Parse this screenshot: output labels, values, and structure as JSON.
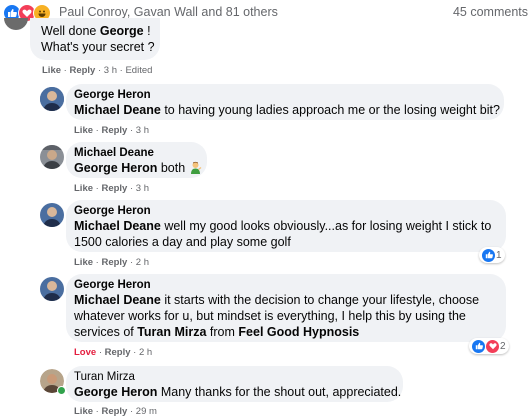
{
  "header": {
    "reactions": [
      "like",
      "love",
      "haha"
    ],
    "names": "Paul Conroy, Gavan Wall and 81 others",
    "comments_count": "45 comments"
  },
  "comments": [
    {
      "author": "",
      "lines": [
        [
          {
            "t": "Well done "
          },
          {
            "t": "George",
            "b": true
          },
          {
            "t": " !"
          }
        ],
        [
          {
            "t": "What's your secret ?"
          }
        ]
      ],
      "like": "Like",
      "reply": "Reply",
      "time": "3 h",
      "edited": "Edited"
    },
    {
      "author": "George Heron",
      "lines": [
        [
          {
            "t": "Michael Deane",
            "b": true
          },
          {
            "t": " to having young ladies approach me or the losing weight bit?"
          }
        ]
      ],
      "like": "Like",
      "reply": "Reply",
      "time": "3 h"
    },
    {
      "author": "Michael Deane",
      "lines": [
        [
          {
            "t": "George Heron",
            "b": true
          },
          {
            "t": " both "
          }
        ]
      ],
      "emoji": "man-gesturing-icon",
      "like": "Like",
      "reply": "Reply",
      "time": "3 h"
    },
    {
      "author": "George Heron",
      "lines": [
        [
          {
            "t": "Michael Deane",
            "b": true
          },
          {
            "t": " well my good looks obviously...as for losing weight I stick to"
          }
        ],
        [
          {
            "t": "1500 calories a day and play some golf"
          }
        ]
      ],
      "like": "Like",
      "reply": "Reply",
      "time": "2 h",
      "reaction_count": "1"
    },
    {
      "author": "George Heron",
      "lines": [
        [
          {
            "t": "Michael Deane",
            "b": true
          },
          {
            "t": " it starts with the decision to change your lifestyle, choose"
          }
        ],
        [
          {
            "t": "whatever works for u, but mindset is everything, I help this by using the"
          }
        ],
        [
          {
            "t": "services of "
          },
          {
            "t": "Turan Mirza",
            "b": true
          },
          {
            "t": " from "
          },
          {
            "t": "Feel Good Hypnosis",
            "b": true
          }
        ]
      ],
      "like": "Love",
      "reply": "Reply",
      "time": "2 h",
      "reaction_count": "2"
    },
    {
      "author": "Turan Mirza",
      "lines": [
        [
          {
            "t": "George Heron",
            "b": true
          },
          {
            "t": " Many thanks for the shout out, appreciated."
          }
        ]
      ],
      "like": "Like",
      "reply": "Reply",
      "time": "29 m"
    }
  ],
  "colors": {
    "like_blue": "#1877f2",
    "love_red": "#f33e58",
    "bubble_bg": "#f0f2f5",
    "meta_gray": "#65676b"
  }
}
